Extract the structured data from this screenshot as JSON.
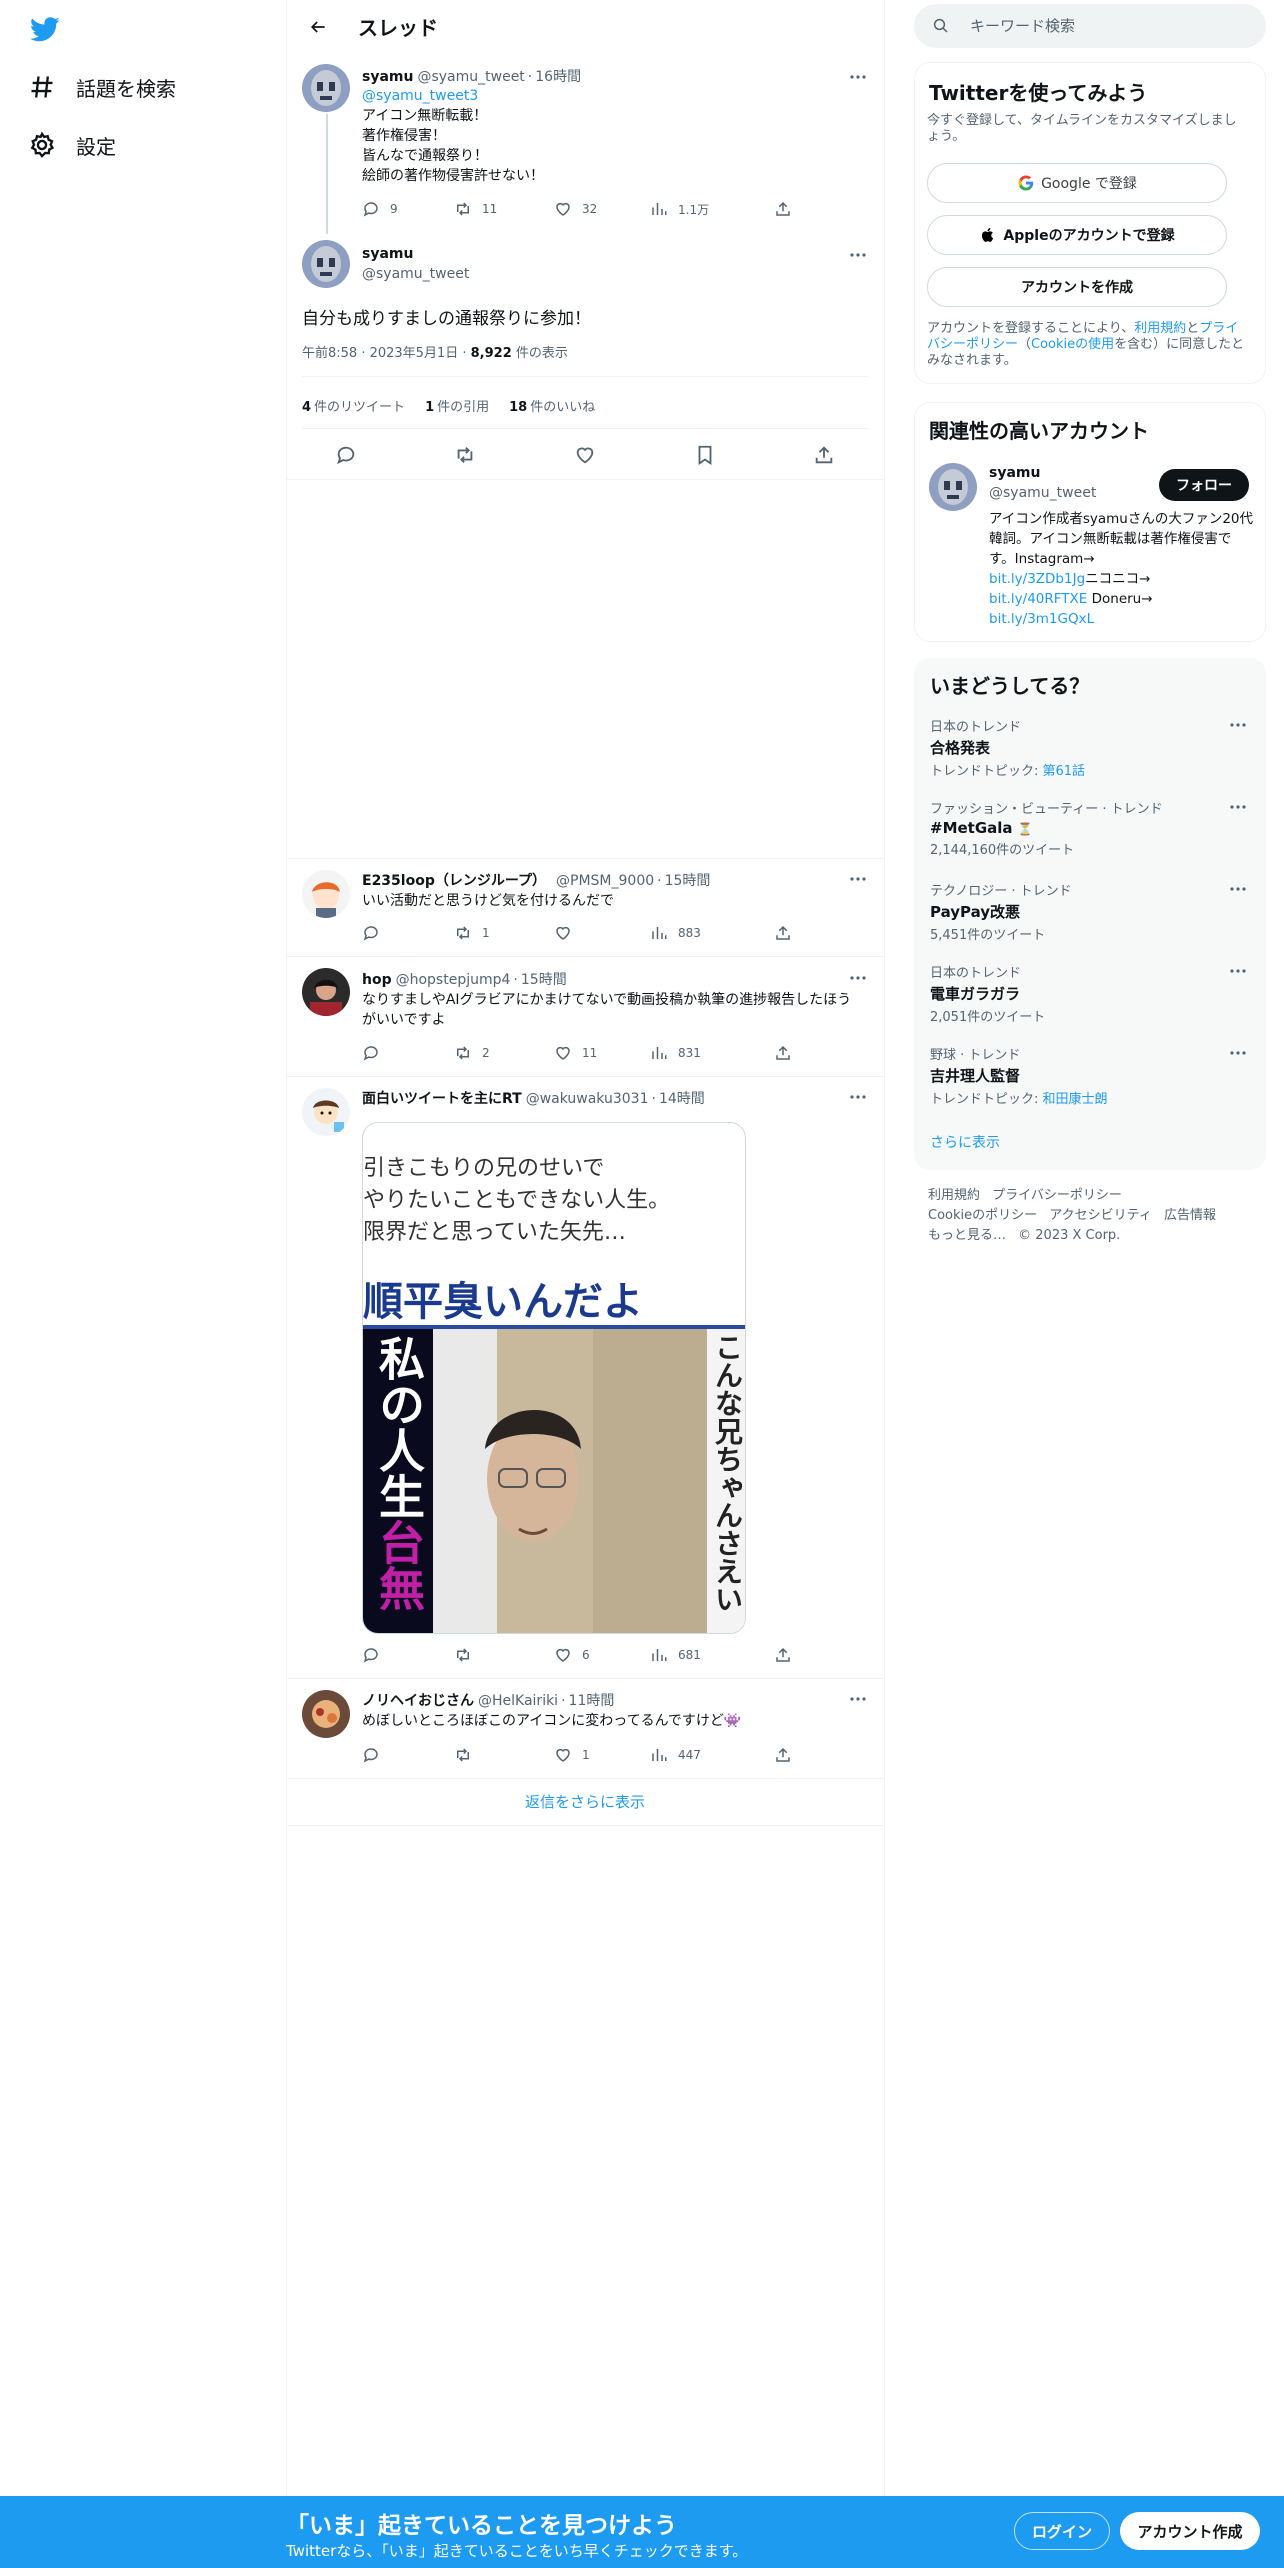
{
  "nav": {
    "logo_icon": "twitter-bird-icon",
    "items": [
      {
        "label": "話題を検索",
        "icon": "hashtag-icon"
      },
      {
        "label": "設定",
        "icon": "gear-icon"
      }
    ]
  },
  "header": {
    "title": "スレッド",
    "back_icon": "arrow-left-icon"
  },
  "parent_tweet": {
    "name": "syamu",
    "handle": "@syamu_tweet",
    "time": "16時間",
    "mention": "@syamu_tweet3",
    "lines": [
      "アイコン無断転載！",
      "著作権侵害！",
      "皆んなで通報祭り！",
      "絵師の著作物侵害許せない！"
    ],
    "replies": "9",
    "retweets": "11",
    "likes": "32",
    "views": "1.1万"
  },
  "main_tweet": {
    "name": "syamu",
    "handle": "@syamu_tweet",
    "text": "自分も成りすましの通報祭りに参加！",
    "timestamp": "午前8:58 · 2023年5月1日 · ",
    "views_count": "8,922",
    "views_label": " 件の表示",
    "retweets_count": "4",
    "retweets_label": "件のリツイート",
    "quotes_count": "1",
    "quotes_label": "件の引用",
    "likes_count": "18",
    "likes_label": "件のいいね"
  },
  "replies": [
    {
      "name": "E235loop（レンジループ）",
      "handle": "@PMSM_9000",
      "time": "15時間",
      "text": "いい活動だと思うけど気を付けるんだで",
      "replies": "",
      "retweets": "1",
      "likes": "",
      "views": "883"
    },
    {
      "name": "hop",
      "handle": "@hopstepjump4",
      "time": "15時間",
      "text": "なりすましやAIグラビアにかまけてないで動画投稿か執筆の進捗報告したほうがいいですよ",
      "replies": "",
      "retweets": "2",
      "likes": "11",
      "views": "831"
    },
    {
      "name": "面白いツイートを主にRT",
      "handle": "@wakuwaku3031",
      "time": "14時間",
      "text": "",
      "replies": "",
      "retweets": "",
      "likes": "6",
      "views": "681"
    },
    {
      "name": "ノリヘイおじさん",
      "handle": "@HelKairiki",
      "time": "11時間",
      "text": "めぼしいところほぼこのアイコンに変わってるんですけど👾",
      "replies": "",
      "retweets": "",
      "likes": "1",
      "views": "447"
    }
  ],
  "media_text": {
    "line1": "引きこもりの兄のせいで",
    "line2": "やりたいこともできない人生。",
    "line3": "限界だと思っていた矢先…",
    "headline": "順平臭いんだよ",
    "vertical_left_1": "私の人生",
    "vertical_left_2": "台無",
    "vertical_right": "こんな兄ちゃんさえい"
  },
  "show_more": "返信をさらに表示",
  "search": {
    "placeholder": "キーワード検索"
  },
  "signup_card": {
    "title": "Twitterを使ってみよう",
    "subtitle": "今すぐ登録して、タイムラインをカスタマイズしましょう。",
    "google": "Google で登録",
    "apple": "Appleのアカウントで登録",
    "create": "アカウントを作成",
    "legal_1": "アカウントを登録することにより、",
    "legal_terms": "利用規約",
    "legal_2": "と",
    "legal_privacy": "プライバシーポリシー",
    "legal_3": "（",
    "legal_cookie": "Cookieの使用",
    "legal_4": "を含む）に同意したとみなされます。"
  },
  "related": {
    "title": "関連性の高いアカウント",
    "name": "syamu",
    "handle": "@syamu_tweet",
    "follow": "フォロー",
    "bio_1": "アイコン作成者syamuさんの大ファン20代韓詞。アイコン無断転載は著作権侵害です。Instagram→",
    "link_1": "bit.ly/3ZDb1Jg",
    "bio_2": "ニコニコ→",
    "link_2": "bit.ly/40RFTXE",
    "bio_3": " Doneru→",
    "link_3": "bit.ly/3m1GQxL"
  },
  "trends": {
    "title": "いまどうしてる？",
    "items": [
      {
        "category": "日本のトレンド",
        "name": "合格発表",
        "sub_prefix": "トレンドトピック: ",
        "sub_link": "第61話",
        "sub": ""
      },
      {
        "category": "ファッション・ビューティー · トレンド",
        "name": "#MetGala",
        "sub_prefix": "",
        "sub_link": "",
        "sub": "2,144,160件のツイート"
      },
      {
        "category": "テクノロジー · トレンド",
        "name": "PayPay改悪",
        "sub_prefix": "",
        "sub_link": "",
        "sub": "5,451件のツイート"
      },
      {
        "category": "日本のトレンド",
        "name": "電車ガラガラ",
        "sub_prefix": "",
        "sub_link": "",
        "sub": "2,051件のツイート"
      },
      {
        "category": "野球 · トレンド",
        "name": "吉井理人監督",
        "sub_prefix": "トレンドトピック: ",
        "sub_link": "和田康士朗",
        "sub": ""
      }
    ],
    "show_more": "さらに表示"
  },
  "footer": {
    "terms": "利用規約",
    "privacy": "プライバシーポリシー",
    "cookie": "Cookieのポリシー",
    "accessibility": "アクセシビリティ",
    "ads": "広告情報",
    "more": "もっと見る…",
    "copyright": "© 2023 X Corp."
  },
  "bottom_bar": {
    "title": "「いま」起きていることを見つけよう",
    "subtitle": "Twitterなら、「いま」起きていることをいち早くチェックできます。",
    "login": "ログイン",
    "signup": "アカウント作成"
  },
  "colors": {
    "accent": "#1d9bf0",
    "text": "#0f1419",
    "secondary": "#536471",
    "border": "#eff3f4"
  }
}
